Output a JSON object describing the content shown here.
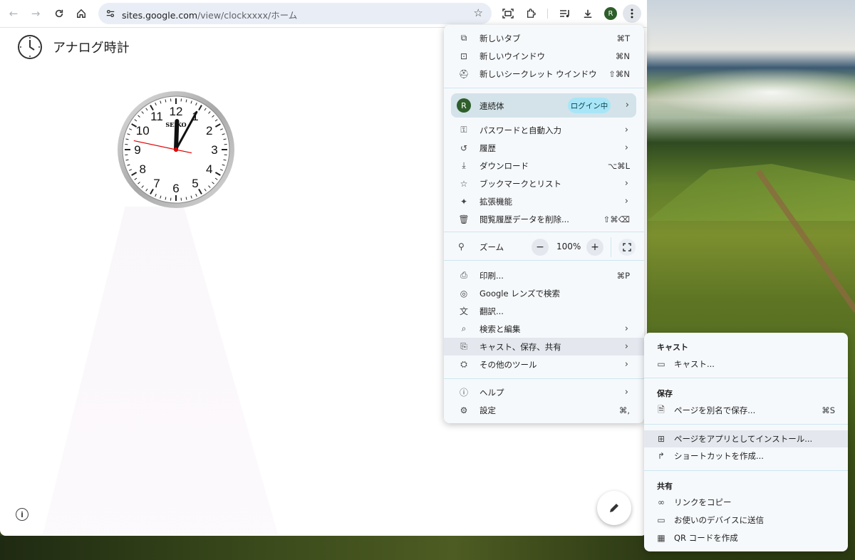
{
  "browser": {
    "url_host": "sites.google.com",
    "url_path": "/view/clockxxxx/ホーム",
    "profile_initial": "R"
  },
  "page": {
    "title": "アナログ時計",
    "clock": {
      "brand": "SEIKO",
      "numbers": [
        "12",
        "1",
        "2",
        "3",
        "4",
        "5",
        "6",
        "7",
        "8",
        "9",
        "10",
        "11"
      ],
      "time": {
        "hour": 12,
        "minute": 4,
        "second": 47
      }
    }
  },
  "menu": {
    "items_top": [
      {
        "icon": "new-tab-icon",
        "label": "新しいタブ",
        "shortcut": "⌘T"
      },
      {
        "icon": "new-window-icon",
        "label": "新しいウインドウ",
        "shortcut": "⌘N"
      },
      {
        "icon": "incognito-icon",
        "label": "新しいシークレット ウインドウ",
        "shortcut": "⇧⌘N"
      }
    ],
    "profile": {
      "initial": "R",
      "name": "連続体",
      "badge": "ログイン中"
    },
    "items_mid": [
      {
        "icon": "key-icon",
        "label": "パスワードと自動入力",
        "shortcut": "",
        "submenu": true
      },
      {
        "icon": "history-icon",
        "label": "履歴",
        "shortcut": "",
        "submenu": true
      },
      {
        "icon": "download-icon",
        "label": "ダウンロード",
        "shortcut": "⌥⌘L",
        "submenu": false
      },
      {
        "icon": "star-icon",
        "label": "ブックマークとリスト",
        "shortcut": "",
        "submenu": true
      },
      {
        "icon": "extension-icon",
        "label": "拡張機能",
        "shortcut": "",
        "submenu": true
      },
      {
        "icon": "trash-icon",
        "label": "閲覧履歴データを削除...",
        "shortcut": "⇧⌘⌫",
        "submenu": false
      }
    ],
    "zoom": {
      "label": "ズーム",
      "value": "100%"
    },
    "items_tools": [
      {
        "icon": "print-icon",
        "label": "印刷...",
        "shortcut": "⌘P",
        "submenu": false
      },
      {
        "icon": "lens-icon",
        "label": "Google レンズで検索",
        "shortcut": "",
        "submenu": false
      },
      {
        "icon": "translate-icon",
        "label": "翻訳...",
        "shortcut": "",
        "submenu": false
      },
      {
        "icon": "find-icon",
        "label": "検索と編集",
        "shortcut": "",
        "submenu": true
      },
      {
        "icon": "cast-save-share-icon",
        "label": "キャスト、保存、共有",
        "shortcut": "",
        "submenu": true
      },
      {
        "icon": "toolbox-icon",
        "label": "その他のツール",
        "shortcut": "",
        "submenu": true
      }
    ],
    "items_bottom": [
      {
        "icon": "help-icon",
        "label": "ヘルプ",
        "shortcut": "",
        "submenu": true
      },
      {
        "icon": "settings-icon",
        "label": "設定",
        "shortcut": "⌘,",
        "submenu": false
      }
    ]
  },
  "submenu": {
    "cast_header": "キャスト",
    "cast_item": "キャスト...",
    "save_header": "保存",
    "save_page": "ページを別名で保存...",
    "save_page_shortcut": "⌘S",
    "install_app": "ページをアプリとしてインストール...",
    "create_shortcut": "ショートカットを作成...",
    "share_header": "共有",
    "copy_link": "リンクをコピー",
    "send_device": "お使いのデバイスに送信",
    "qr_code": "QR コードを作成"
  },
  "colors": {
    "accent": "#0b57d0",
    "badge": "#a8e6f7",
    "avatar": "#2e5e2a",
    "second_hand": "#e00000"
  }
}
